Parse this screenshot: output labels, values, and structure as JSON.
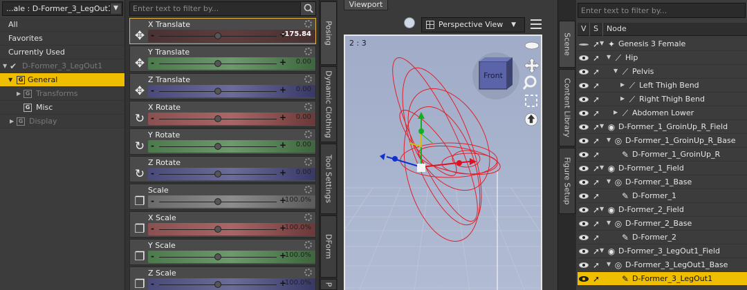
{
  "left_panel": {
    "node_selector": "...ale : D-Former_3_LegOut1",
    "categories": [
      {
        "label": "All"
      },
      {
        "label": "Favorites"
      },
      {
        "label": "Currently Used"
      }
    ],
    "tree": [
      {
        "label": "D-Former_3_LegOut1"
      },
      {
        "label": "General"
      },
      {
        "label": "Transforms"
      },
      {
        "label": "Misc"
      },
      {
        "label": "Display"
      }
    ],
    "icon_letter": "G"
  },
  "parameters": {
    "filter_placeholder": "Enter text to filter by...",
    "items": [
      {
        "name": "X Translate",
        "value": "-175.84",
        "slider_fraction": 0.5,
        "color": "#aa6666",
        "active": true
      },
      {
        "name": "Y Translate",
        "value": "0.00",
        "slider_fraction": 0.5,
        "color": "#6c9a6c"
      },
      {
        "name": "Z Translate",
        "value": "0.00",
        "slider_fraction": 0.5,
        "color": "#6c6c9a"
      },
      {
        "name": "X Rotate",
        "value": "0.00",
        "slider_fraction": 0.5,
        "color": "#aa6666"
      },
      {
        "name": "Y Rotate",
        "value": "0.00",
        "slider_fraction": 0.5,
        "color": "#6c9a6c"
      },
      {
        "name": "Z Rotate",
        "value": "0.00",
        "slider_fraction": 0.5,
        "color": "#6c6c9a"
      },
      {
        "name": "Scale",
        "value": "100.0%",
        "slider_fraction": 0.5,
        "color": "#8c8c8c"
      },
      {
        "name": "X Scale",
        "value": "100.0%",
        "slider_fraction": 0.5,
        "color": "#aa6666"
      },
      {
        "name": "Y Scale",
        "value": "100.0%",
        "slider_fraction": 0.5,
        "color": "#6c9a6c"
      },
      {
        "name": "Z Scale",
        "value": "100.0%",
        "slider_fraction": 0.5,
        "color": "#6c6c9a"
      }
    ]
  },
  "side_tabs_left": [
    "Posing",
    "Dynamic Clothing",
    "Tool Settings",
    "DForm",
    "P"
  ],
  "viewport": {
    "tab": "Viewport",
    "camera": "Perspective View",
    "ratio": "2 : 3",
    "cube_label": "Front"
  },
  "side_tabs_right": [
    "Scene",
    "Content Library",
    "Figure Setup"
  ],
  "scene": {
    "filter_placeholder": "Enter text to filter by...",
    "columns": {
      "v": "V",
      "s": "S",
      "node": "Node"
    },
    "rows": [
      {
        "label": "Genesis 3 Female",
        "depth": 0,
        "icon": "figure"
      },
      {
        "label": "Hip",
        "depth": 1,
        "icon": "bone"
      },
      {
        "label": "Pelvis",
        "depth": 2,
        "icon": "bone"
      },
      {
        "label": "Left Thigh Bend",
        "depth": 3,
        "icon": "bone"
      },
      {
        "label": "Right Thigh Bend",
        "depth": 3,
        "icon": "bone"
      },
      {
        "label": "Abdomen Lower",
        "depth": 2,
        "icon": "bone"
      },
      {
        "label": "D-Former_1_GroinUp_R_Field",
        "depth": 0,
        "icon": "field"
      },
      {
        "label": "D-Former_1_GroinUp_R_Base",
        "depth": 1,
        "icon": "base"
      },
      {
        "label": "D-Former_1_GroinUp_R",
        "depth": 2,
        "icon": "dformer"
      },
      {
        "label": "D-Former_1_Field",
        "depth": 0,
        "icon": "field"
      },
      {
        "label": "D-Former_1_Base",
        "depth": 1,
        "icon": "base"
      },
      {
        "label": "D-Former_1",
        "depth": 2,
        "icon": "dformer"
      },
      {
        "label": "D-Former_2_Field",
        "depth": 0,
        "icon": "field"
      },
      {
        "label": "D-Former_2_Base",
        "depth": 1,
        "icon": "base"
      },
      {
        "label": "D-Former_2",
        "depth": 2,
        "icon": "dformer"
      },
      {
        "label": "D-Former_3_LegOut1_Field",
        "depth": 0,
        "icon": "field"
      },
      {
        "label": "D-Former_3_LegOut1_Base",
        "depth": 1,
        "icon": "base"
      },
      {
        "label": "D-Former_3_LegOut1",
        "depth": 2,
        "icon": "dformer",
        "selected": true
      }
    ]
  },
  "colors": {
    "selection": "#f0be00",
    "wire_red": "#e0202a",
    "viewport_bg": "#a8b3cc"
  }
}
